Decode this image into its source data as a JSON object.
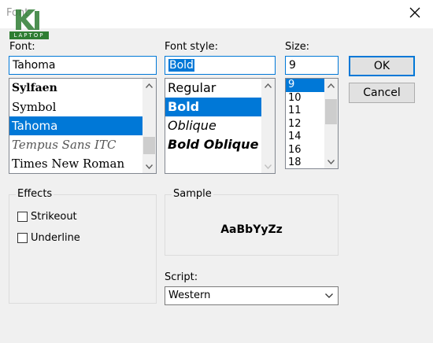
{
  "window": {
    "title": "Font"
  },
  "logo": {
    "text": "LAPTOP"
  },
  "font": {
    "label": "Font:",
    "value": "Tahoma",
    "items": [
      "Sylfaen",
      "Symbol",
      "Tahoma",
      "Tempus Sans ITC",
      "Times New Roman"
    ],
    "selected_index": 2
  },
  "style": {
    "label": "Font style:",
    "value": "Bold",
    "items": [
      "Regular",
      "Bold",
      "Oblique",
      "Bold Oblique"
    ],
    "selected_index": 1
  },
  "size": {
    "label": "Size:",
    "value": "9",
    "items": [
      "9",
      "10",
      "11",
      "12",
      "14",
      "16",
      "18"
    ],
    "selected_index": 0
  },
  "buttons": {
    "ok": "OK",
    "cancel": "Cancel"
  },
  "effects": {
    "title": "Effects",
    "strikeout": {
      "label": "Strikeout",
      "checked": false
    },
    "underline": {
      "label": "Underline",
      "checked": false
    }
  },
  "sample": {
    "title": "Sample",
    "text": "AaBbYyZz"
  },
  "script": {
    "label": "Script:",
    "value": "Western"
  },
  "colors": {
    "accent": "#0078d7",
    "dialog_bg": "#f0f0f0",
    "logo_green": "#2e7d32"
  },
  "icons": {
    "close": "close-icon",
    "scroll_up": "chevron-up-icon",
    "scroll_down": "chevron-down-icon",
    "dropdown": "chevron-down-icon"
  }
}
